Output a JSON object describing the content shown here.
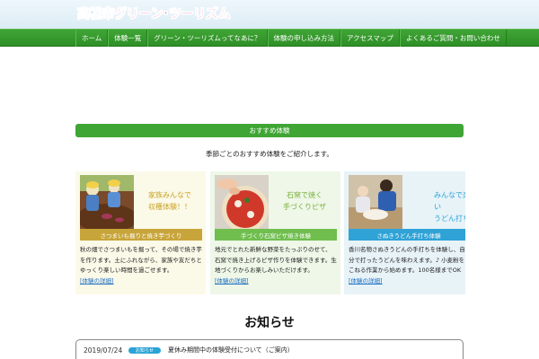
{
  "header": {
    "logo_city": "高松市",
    "logo_gt": "グリーン･ツーリズム"
  },
  "nav": {
    "items": [
      {
        "label": "ホーム"
      },
      {
        "label": "体験一覧"
      },
      {
        "label": "グリーン・ツーリズムってなあに？"
      },
      {
        "label": "体験の申し込み方法"
      },
      {
        "label": "アクセスマップ"
      },
      {
        "label": "よくあるご質問・お問い合わせ"
      }
    ]
  },
  "section": {
    "heading": "おすすめ体験",
    "description": "季節ごとのおすすめ体験をご紹介します。"
  },
  "cards": [
    {
      "catch_line1": "家族みんなで",
      "catch_line2": "収穫体験！！",
      "label": "さつまいも掘りと焼き芋づくり",
      "text": "秋の畑でさつまいもを掘って、その場で焼き芋を作ります。土にふれながら、家族や友だちとゆっくり楽しい時間を過ごせます。",
      "link": "[体験の詳細]"
    },
    {
      "catch_line1": "石窯で焼く",
      "catch_line2": "手づくりピザ",
      "label": "手づくり石窯ピザ焼き体験",
      "text": "地元でとれた新鮮な野菜をたっぷりのせて、石窯で焼き上げるピザ作りを体験できます。生地づくりからお楽しみいただけます。",
      "link": "[体験の詳細]"
    },
    {
      "catch_line1": "みんなで楽しい",
      "catch_line2": "うどん打ち",
      "label": "さぬきうどん手打ち体験",
      "text": "香川名物さぬきうどんの手打ちを体験し、自分で打ったうどんを味わえます。♪ 小麦粉をこねる作業から始めます。100名様までOK",
      "link": "[体験の詳細]"
    }
  ],
  "news": {
    "title": "お知らせ",
    "items": [
      {
        "date": "2019/07/24",
        "badge": "お知らせ",
        "text": "夏休み期間中の体験受付について（ご案内）"
      }
    ]
  },
  "colors": {
    "nav_green": "#3fa535",
    "accent_blue": "#2aa3d6",
    "logo_blue": "#1e6fc0",
    "logo_pink": "#e8348a"
  }
}
